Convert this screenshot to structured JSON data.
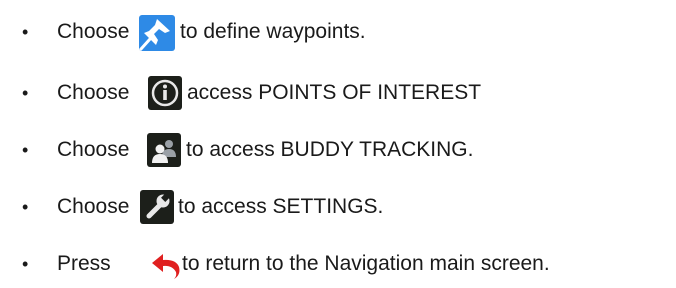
{
  "bullet": "•",
  "items": [
    {
      "verb": "Choose",
      "icon": "pushpin-icon",
      "text": "to define waypoints."
    },
    {
      "verb": "Choose",
      "icon": "info-icon",
      "text": "access POINTS OF INTEREST"
    },
    {
      "verb": "Choose",
      "icon": "buddy-tracking-icon",
      "text": "to access BUDDY TRACKING."
    },
    {
      "verb": "Choose",
      "icon": "wrench-icon",
      "text": "to access SETTINGS."
    },
    {
      "verb": "Press",
      "icon": "back-arrow-icon",
      "text": "to return to the Navigation main screen."
    }
  ],
  "colors": {
    "pin_tile": "#2e8ae6",
    "dark_tile": "#1c1f1a",
    "back_arrow": "#e02020"
  }
}
